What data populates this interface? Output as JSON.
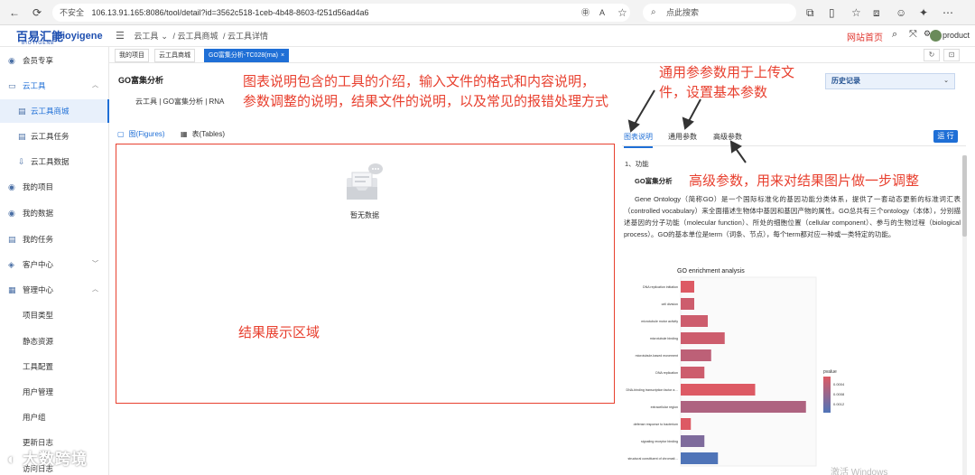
{
  "browser": {
    "insecure": "不安全",
    "url": "106.13.91.165:8086/tool/detail?id=3562c518-1ceb-4b48-8603-f251d56ad4a6",
    "search_placeholder": "点此搜索"
  },
  "app": {
    "logo_cn": "百易汇能",
    "logo_en": "Bioyigene",
    "logo_sub": "BIOYIGENE",
    "breadcrumb": [
      "云工具",
      "云工具商城",
      "云工具详情"
    ],
    "site_home": "网站首页",
    "username": "product"
  },
  "sidebar": {
    "items": [
      {
        "label": "会员专享",
        "icon": "member-icon"
      },
      {
        "label": "云工具",
        "icon": "cloud-icon"
      },
      {
        "label": "云工具商城",
        "icon": "store-icon"
      },
      {
        "label": "云工具任务",
        "icon": "task-icon"
      },
      {
        "label": "云工具数据",
        "icon": "data-icon"
      },
      {
        "label": "我的项目",
        "icon": "project-icon"
      },
      {
        "label": "我的数据",
        "icon": "mydata-icon"
      },
      {
        "label": "我的任务",
        "icon": "mytask-icon"
      },
      {
        "label": "客户中心",
        "icon": "customer-icon"
      },
      {
        "label": "管理中心",
        "icon": "admin-icon"
      },
      {
        "label": "项目类型"
      },
      {
        "label": "静态资源"
      },
      {
        "label": "工具配置"
      },
      {
        "label": "用户管理"
      },
      {
        "label": "用户组"
      },
      {
        "label": "更新日志"
      },
      {
        "label": "访问日志"
      }
    ]
  },
  "page_tabs": [
    {
      "label": "我的项目"
    },
    {
      "label": "云工具商城"
    },
    {
      "label": "GO富集分析-TC028(rna)",
      "close": "×"
    }
  ],
  "tool": {
    "title": "GO富集分析",
    "subtitle": "云工具 | GO富集分析 | RNA",
    "history": "历史记录"
  },
  "result_tabs": {
    "figures": "图(Figures)",
    "tables": "表(Tables)",
    "empty": "暂无数据"
  },
  "right_tabs": {
    "tab1": "图表说明",
    "tab2": "通用参数",
    "tab3": "高级参数",
    "run": "运 行"
  },
  "content": {
    "section1": "1、功能",
    "section2": "GO富集分析",
    "description": "Gene Ontology（简称GO）是一个国际标准化的基因功能分类体系，提供了一套动态更新的标准词汇表（controlled vocabulary）来全面描述生物体中基因和基因产物的属性。GO总共有三个ontology（本体），分别描述基因的分子功能（molecular function）、所处的细胞位置（cellular component）、参与的生物过程（biological process）。GO的基本单位是term（词条、节点），每个term都对应一种或一类特定的功能。"
  },
  "annotations": {
    "a1_line1": "图表说明包含的工具的介绍，输入文件的格式和内容说明，",
    "a1_line2": "参数调整的说明，结果文件的说明，以及常见的报错处理方式",
    "a2_line1": "通用参参数用于上传文",
    "a2_line2": "件，设置基本参数",
    "a3": "高级参数，用来对结果图片做一步调整",
    "a4": "结果展示区域"
  },
  "watermark": "大数跨境",
  "windows_activate": "激活 Windows",
  "chart_data": {
    "type": "bar",
    "title": "GO enrichment analysis",
    "categories": [
      "DNA replication initiation",
      "cell division",
      "microtubule motor activity",
      "microtubule binding",
      "microtubule-based movement",
      "DNA replication",
      "DNA-binding transcription factor activity, RNA polymerase II-specific",
      "extracellular region",
      "defense response to bacterium",
      "signaling receptor binding",
      "structural constituent of chromatin"
    ],
    "values": [
      4,
      4,
      8,
      13,
      9,
      7,
      22,
      37,
      3,
      7,
      11
    ],
    "pvalues": [
      0.0003,
      0.0004,
      0.0004,
      0.0004,
      0.0005,
      0.0004,
      0.0003,
      0.0006,
      0.0003,
      0.0009,
      0.0012
    ],
    "legend_title": "pvalue",
    "legend_ticks": [
      "0.0004",
      "0.0008",
      "0.0012"
    ],
    "color_low": "#dd5a64",
    "color_high": "#4f74b8",
    "xlim": [
      0,
      40
    ]
  }
}
